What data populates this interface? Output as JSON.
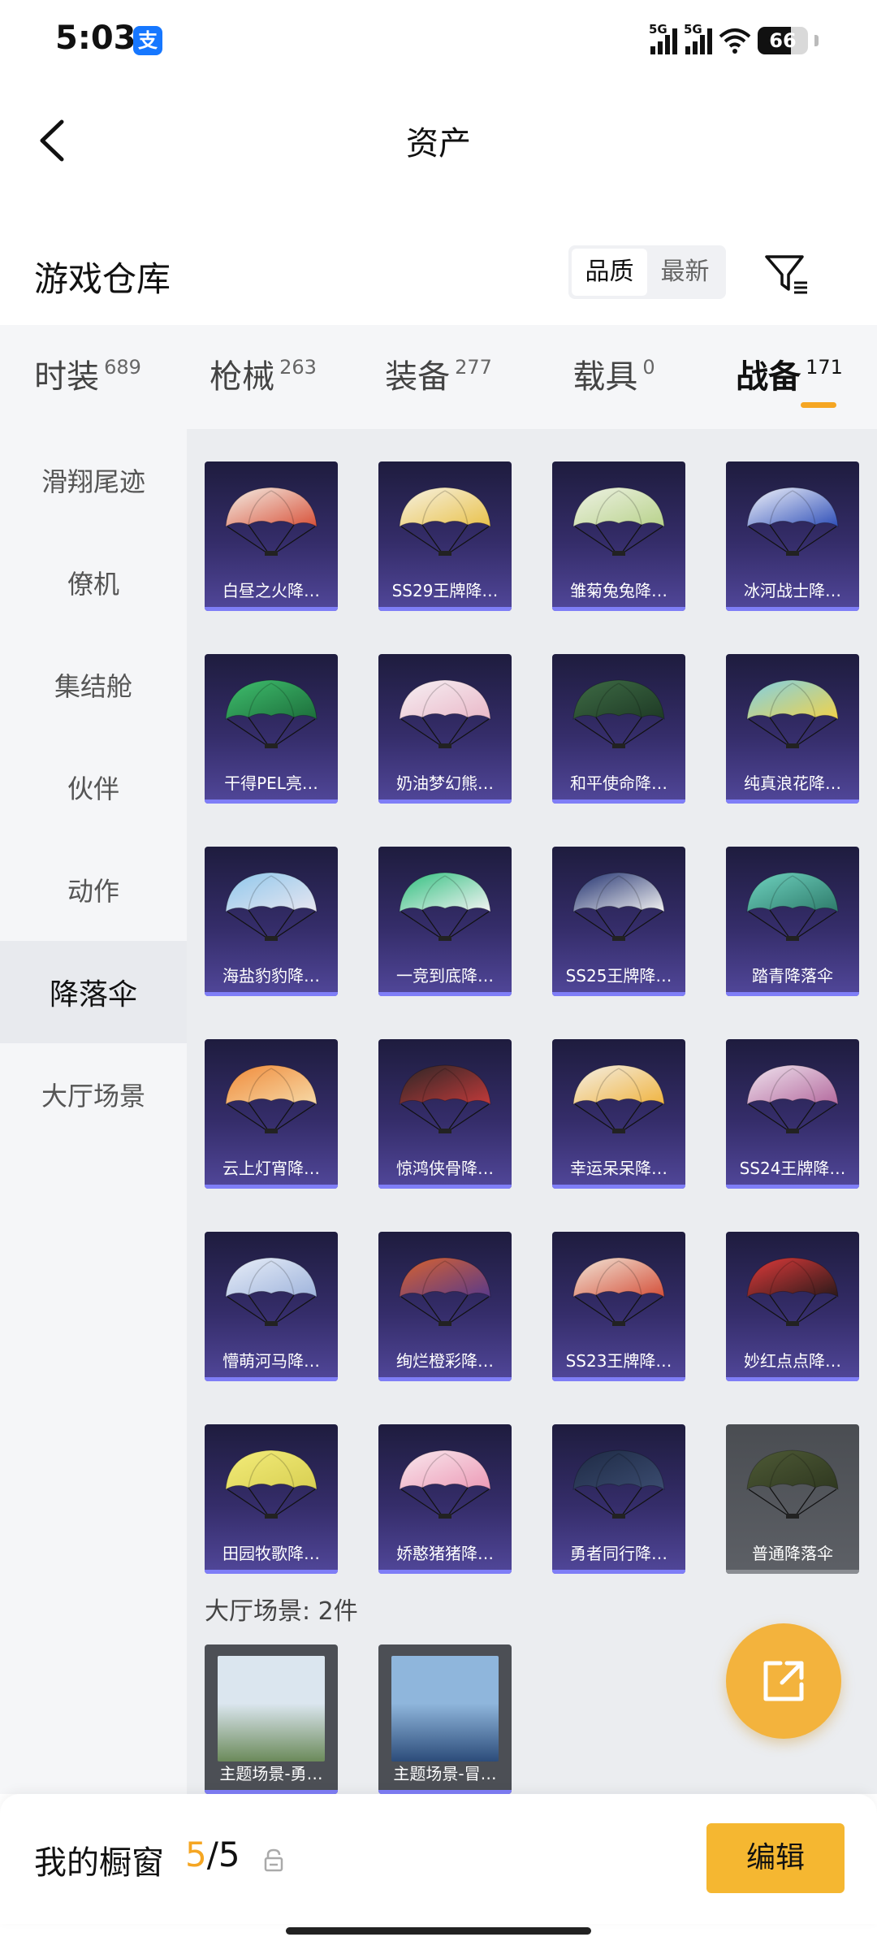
{
  "status_bar": {
    "time": "5:03",
    "alipay_badge": "支",
    "signal_1": "5G",
    "signal_2": "5G",
    "battery": "66",
    "battery_level": 0.66
  },
  "nav": {
    "title": "资产"
  },
  "header": {
    "title": "游戏仓库",
    "sort_options": [
      "品质",
      "最新"
    ],
    "sort_active": "品质"
  },
  "tabs": [
    {
      "label": "时装",
      "count": "689"
    },
    {
      "label": "枪械",
      "count": "263"
    },
    {
      "label": "装备",
      "count": "277"
    },
    {
      "label": "载具",
      "count": "0"
    },
    {
      "label": "战备",
      "count": "171",
      "active": true
    }
  ],
  "sidebar": {
    "items": [
      "滑翔尾迹",
      "僚机",
      "集结舱",
      "伙伴",
      "动作",
      "降落伞",
      "大厅场景"
    ],
    "active_index": 5
  },
  "parachutes": [
    {
      "name": "白昼之火降…",
      "c1": "#f4efe6",
      "c2": "#d8523a",
      "plain": false
    },
    {
      "name": "SS29王牌降…",
      "c1": "#f6f1e2",
      "c2": "#e9c24b",
      "plain": false
    },
    {
      "name": "雏菊兔兔降…",
      "c1": "#eef2e4",
      "c2": "#b8d28b",
      "plain": false
    },
    {
      "name": "冰河战士降…",
      "c1": "#f2f4fb",
      "c2": "#2f4fb8",
      "plain": false
    },
    {
      "name": "干得PEL亮…",
      "c1": "#3fbf6e",
      "c2": "#1d6e3b",
      "plain": false
    },
    {
      "name": "奶油梦幻熊…",
      "c1": "#f6f0f4",
      "c2": "#eab8c8",
      "plain": false
    },
    {
      "name": "和平使命降…",
      "c1": "#3e6b45",
      "c2": "#1e3a25",
      "plain": false
    },
    {
      "name": "纯真浪花降…",
      "c1": "#7fd0e6",
      "c2": "#f1d24a",
      "plain": false
    },
    {
      "name": "海盐豹豹降…",
      "c1": "#8ec7ec",
      "c2": "#e8e6f0",
      "plain": false
    },
    {
      "name": "一竞到底降…",
      "c1": "#2fbf7e",
      "c2": "#f4f4f4",
      "plain": false
    },
    {
      "name": "SS25王牌降…",
      "c1": "#1f2f6e",
      "c2": "#f2f2f2",
      "plain": false
    },
    {
      "name": "踏青降落伞",
      "c1": "#6fd3c0",
      "c2": "#2e7a6a",
      "plain": false
    },
    {
      "name": "云上灯宵降…",
      "c1": "#f08a3a",
      "c2": "#f6d9a6",
      "plain": false
    },
    {
      "name": "惊鸿侠骨降…",
      "c1": "#2a2626",
      "c2": "#c23a3a",
      "plain": false
    },
    {
      "name": "幸运呆呆降…",
      "c1": "#f4efe6",
      "c2": "#f0b440",
      "plain": false
    },
    {
      "name": "SS24王牌降…",
      "c1": "#efe3ee",
      "c2": "#b46a9e",
      "plain": false
    },
    {
      "name": "懵萌河马降…",
      "c1": "#e8eef8",
      "c2": "#9fb4dc",
      "plain": false
    },
    {
      "name": "绚烂橙彩降…",
      "c1": "#d8622e",
      "c2": "#5a3a8a",
      "plain": false
    },
    {
      "name": "SS23王牌降…",
      "c1": "#f2e6d8",
      "c2": "#d4503a",
      "plain": false
    },
    {
      "name": "妙红点点降…",
      "c1": "#e03a3a",
      "c2": "#2a1a1a",
      "plain": false
    },
    {
      "name": "田园牧歌降…",
      "c1": "#f3ec7a",
      "c2": "#d8cf52",
      "plain": false
    },
    {
      "name": "娇憨猪猪降…",
      "c1": "#f9e8ee",
      "c2": "#ec9ab6",
      "plain": false
    },
    {
      "name": "勇者同行降…",
      "c1": "#1e2a44",
      "c2": "#3b4c70",
      "plain": false
    },
    {
      "name": "普通降落伞",
      "c1": "#4e5a36",
      "c2": "#2f3820",
      "plain": true
    }
  ],
  "scenes": {
    "title": "大厅场景: 2件",
    "items": [
      {
        "name": "主题场景-勇…",
        "sky": "#dbe6ef",
        "ground": "#6b8a5a"
      },
      {
        "name": "主题场景-冒…",
        "sky": "#8fb6dc",
        "ground": "#2c4c7a"
      }
    ]
  },
  "showcase": {
    "label": "我的橱窗",
    "current": "5",
    "total": "/5",
    "edit_label": "编辑"
  }
}
